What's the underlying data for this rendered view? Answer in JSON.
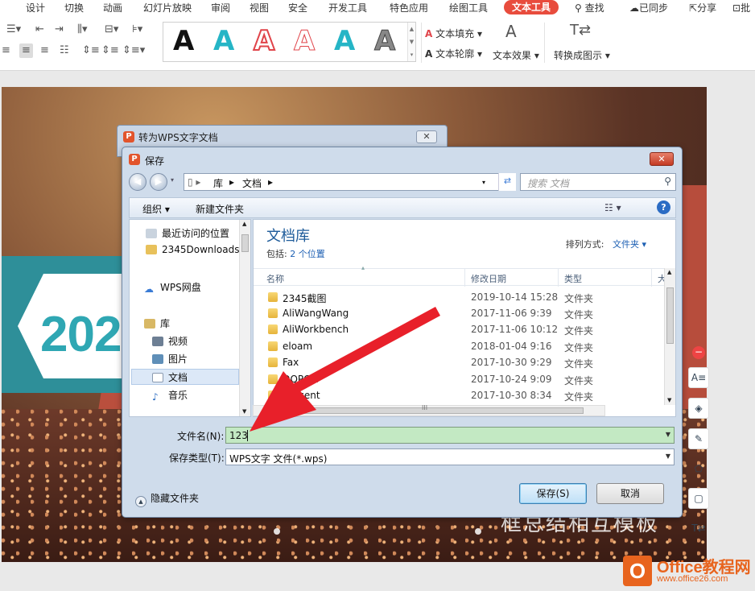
{
  "menu": {
    "items": [
      "设计",
      "切换",
      "动画",
      "幻灯片放映",
      "审阅",
      "视图",
      "安全",
      "开发工具",
      "特色应用",
      "绘图工具",
      "文本工具"
    ],
    "active": "文本工具",
    "search": "查找",
    "sync": "已同步",
    "share": "分享",
    "comment": "批"
  },
  "ribbon": {
    "text_fill": "文本填充",
    "text_outline": "文本轮廓",
    "text_effect": "文本效果",
    "convert_diagram": "转换成图示",
    "style_glyph": "A",
    "style_colors": [
      "#111111",
      "#25b5c6",
      "#e0444a",
      "#e0444a",
      "#25b5c6",
      "#666666"
    ]
  },
  "slide": {
    "year_fragment": "202",
    "bottom_title": "框总结相互模板"
  },
  "outer_dialog": {
    "title": "转为WPS文字文档",
    "close_glyph": "✕"
  },
  "save_dialog": {
    "title": "保存",
    "close_glyph": "✕",
    "address": {
      "seg1": "库",
      "seg2": "文档"
    },
    "search_placeholder": "搜索 文档",
    "commands": {
      "organize": "组织 ▾",
      "new_folder": "新建文件夹",
      "help": "?"
    },
    "tree": [
      {
        "label": "最近访问的位置",
        "icon": "recent-places-icon"
      },
      {
        "label": "2345Downloads",
        "icon": "folder-icon"
      },
      {
        "label": "WPS网盘",
        "icon": "cloud-icon"
      },
      {
        "label": "库",
        "icon": "library-icon"
      },
      {
        "label": "视频",
        "icon": "video-icon"
      },
      {
        "label": "图片",
        "icon": "picture-icon"
      },
      {
        "label": "文档",
        "icon": "document-icon"
      },
      {
        "label": "音乐",
        "icon": "music-icon"
      }
    ],
    "library": {
      "title": "文档库",
      "includes_prefix": "包括:",
      "includes_link": "2 个位置",
      "sort_label": "排列方式:",
      "sort_value": "文件夹 ▾"
    },
    "columns": [
      "名称",
      "修改日期",
      "类型",
      "大"
    ],
    "files": [
      {
        "name": "2345截图",
        "date": "2019-10-14 15:28",
        "type": "文件夹"
      },
      {
        "name": "AliWangWang",
        "date": "2017-11-06 9:39",
        "type": "文件夹"
      },
      {
        "name": "AliWorkbench",
        "date": "2017-11-06 10:12",
        "type": "文件夹"
      },
      {
        "name": "eloam",
        "date": "2018-01-04 9:16",
        "type": "文件夹"
      },
      {
        "name": "Fax",
        "date": "2017-10-30 9:29",
        "type": "文件夹"
      },
      {
        "name": "QQPCM",
        "date": "2017-10-24 9:09",
        "type": "文件夹"
      },
      {
        "name": "Tencent",
        "date": "2017-10-30 8:34",
        "type": "文件夹"
      }
    ],
    "filename_label": "文件名(N):",
    "filename_value": "123",
    "filetype_label": "保存类型(T):",
    "filetype_value": "WPS文字 文件(*.wps)",
    "hide_folders": "隐藏文件夹",
    "save_button": "保存(S)",
    "cancel_button": "取消"
  },
  "watermark": {
    "logo_letter": "O",
    "line1": "Office教程网",
    "line2": "www.office26.com"
  },
  "colors": {
    "accent": "#e84c3d",
    "dialog_frame": "#cfdceb",
    "filename_highlight": "#c3e9c3",
    "arrow": "#e8202a"
  }
}
